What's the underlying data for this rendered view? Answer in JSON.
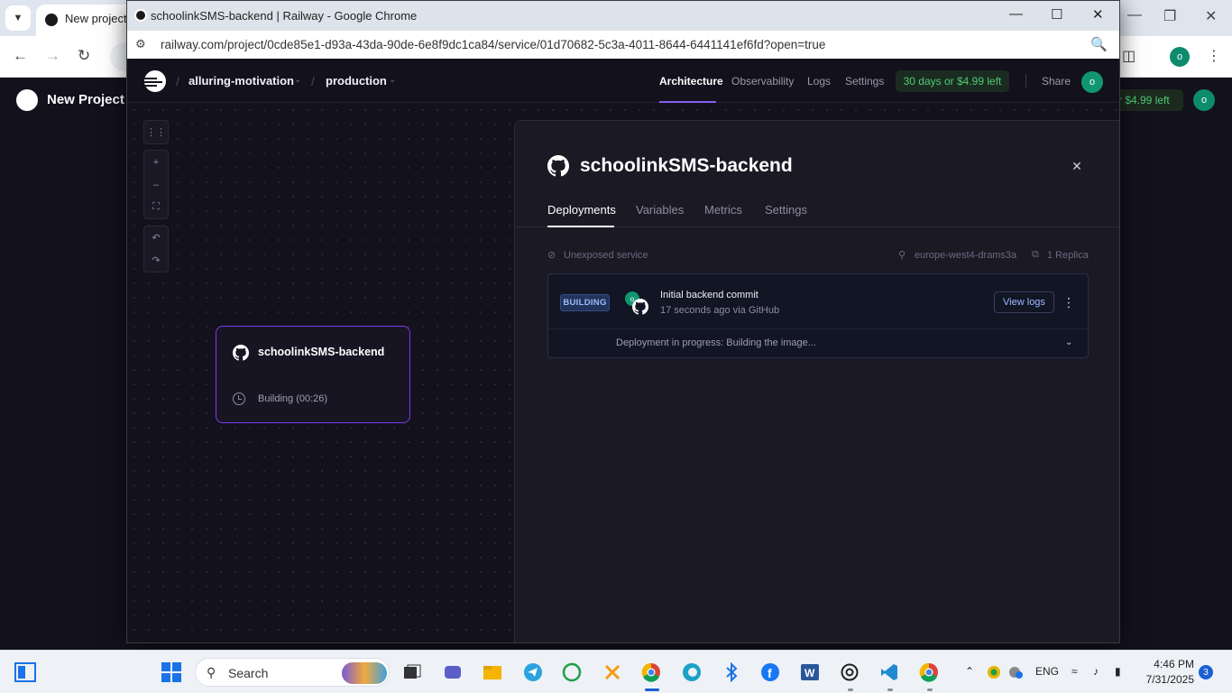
{
  "background_window": {
    "tab_title": "New project",
    "app_title": "New Project",
    "trial_fragment": "r $4.99 left",
    "avatar_initial": "o",
    "profile_initial": "o"
  },
  "window": {
    "title": "schoolinkSMS-backend | Railway - Google Chrome",
    "url": "railway.com/project/0cde85e1-d93a-43da-90de-6e8f9dc1ca84/service/01d70682-5c3a-4011-8644-6441141ef6fd?open=true"
  },
  "header": {
    "project": "alluring-motivation",
    "environment": "production",
    "nav": [
      {
        "label": "Architecture",
        "active": true
      },
      {
        "label": "Observability",
        "active": false
      },
      {
        "label": "Logs",
        "active": false
      },
      {
        "label": "Settings",
        "active": false
      }
    ],
    "trial": "30 days or $4.99 left",
    "share": "Share",
    "avatar": "o"
  },
  "canvas": {
    "tools": [
      "grid-icon",
      "zoom-in-icon",
      "zoom-out-icon",
      "fit-icon",
      "undo-icon",
      "redo-icon"
    ],
    "service_card": {
      "name": "schoolinkSMS-backend",
      "status": "Building (00:26)"
    }
  },
  "panel": {
    "title": "schoolinkSMS-backend",
    "tabs": [
      "Deployments",
      "Variables",
      "Metrics",
      "Settings"
    ],
    "active_tab": "Deployments",
    "meta": {
      "exposure": "Unexposed service",
      "region": "europe-west4-drams3a",
      "replicas": "1 Replica"
    },
    "deployment": {
      "badge": "BUILDING",
      "avatar": "o",
      "commit": "Initial backend commit",
      "time": "17 seconds ago via GitHub",
      "view_logs": "View logs",
      "progress": "Deployment in progress:  Building the image..."
    }
  },
  "taskbar": {
    "search_label": "Search",
    "language": "ENG",
    "time": "4:46 PM",
    "date": "7/31/2025",
    "notifications": "3"
  },
  "colors": {
    "accent": "#8b5cf6",
    "trial_green": "#4ecb71",
    "building_blue": "#9ebbff",
    "app_bg": "#13111c"
  }
}
